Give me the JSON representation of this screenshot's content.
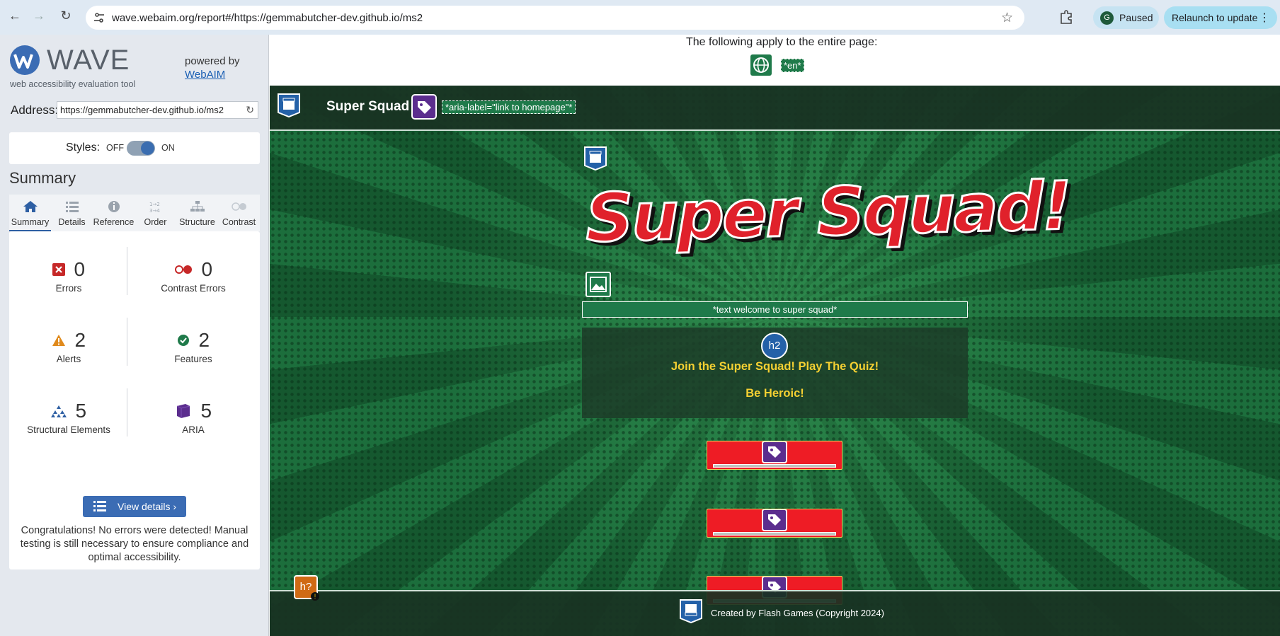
{
  "browser": {
    "url": "wave.webaim.org/report#/https://gemmabutcher-dev.github.io/ms2",
    "profile_initial": "G",
    "profile_status": "Paused",
    "relaunch_label": "Relaunch to update"
  },
  "wave": {
    "logo_text": "WAVE",
    "tagline": "web accessibility evaluation tool",
    "powered_by": "powered by",
    "webaim_link": "WebAIM",
    "address_label": "Address:",
    "address_value": "https://gemmabutcher-dev.github.io/ms2",
    "styles_label": "Styles:",
    "styles_off": "OFF",
    "styles_on": "ON",
    "summary_heading": "Summary",
    "tabs": [
      {
        "label": "Summary",
        "icon": "home-icon"
      },
      {
        "label": "Details",
        "icon": "list-icon"
      },
      {
        "label": "Reference",
        "icon": "info-icon"
      },
      {
        "label": "Order",
        "icon": "order-icon"
      },
      {
        "label": "Structure",
        "icon": "structure-icon"
      },
      {
        "label": "Contrast",
        "icon": "contrast-icon"
      }
    ],
    "stats": {
      "errors": {
        "count": "0",
        "label": "Errors"
      },
      "contrast_errors": {
        "count": "0",
        "label": "Contrast Errors"
      },
      "alerts": {
        "count": "2",
        "label": "Alerts"
      },
      "features": {
        "count": "2",
        "label": "Features"
      },
      "structural": {
        "count": "5",
        "label": "Structural Elements"
      },
      "aria": {
        "count": "5",
        "label": "ARIA"
      }
    },
    "view_details": "View details ›",
    "congrats": "Congratulations! No errors were detected! Manual testing is still necessary to ensure compliance and optimal accessibility."
  },
  "page": {
    "applies_note": "The following apply to the entire page:",
    "lang_tag": "*en*",
    "site_title": "Super Squad",
    "aria_label_tag": "*aria-label=\"link to homepage\"*",
    "hero_title": "Super Squad!",
    "image_alt": "*text welcome to super squad*",
    "h2_badge": "h2",
    "quiz_line1": "Join the Super Squad! Play The Quiz!",
    "quiz_line2": "Be Heroic!",
    "footer_text": "Created by Flash Games (Copyright 2024)",
    "heading_alert_badge": "h?"
  },
  "colors": {
    "wave_blue": "#3b6cb4",
    "feature_green": "#1f7a4a",
    "aria_purple": "#5b2d8e",
    "error_red": "#c62828",
    "alert_orange": "#e08a1c",
    "hero_red": "#e0212b",
    "quiz_yellow": "#f5d032"
  }
}
